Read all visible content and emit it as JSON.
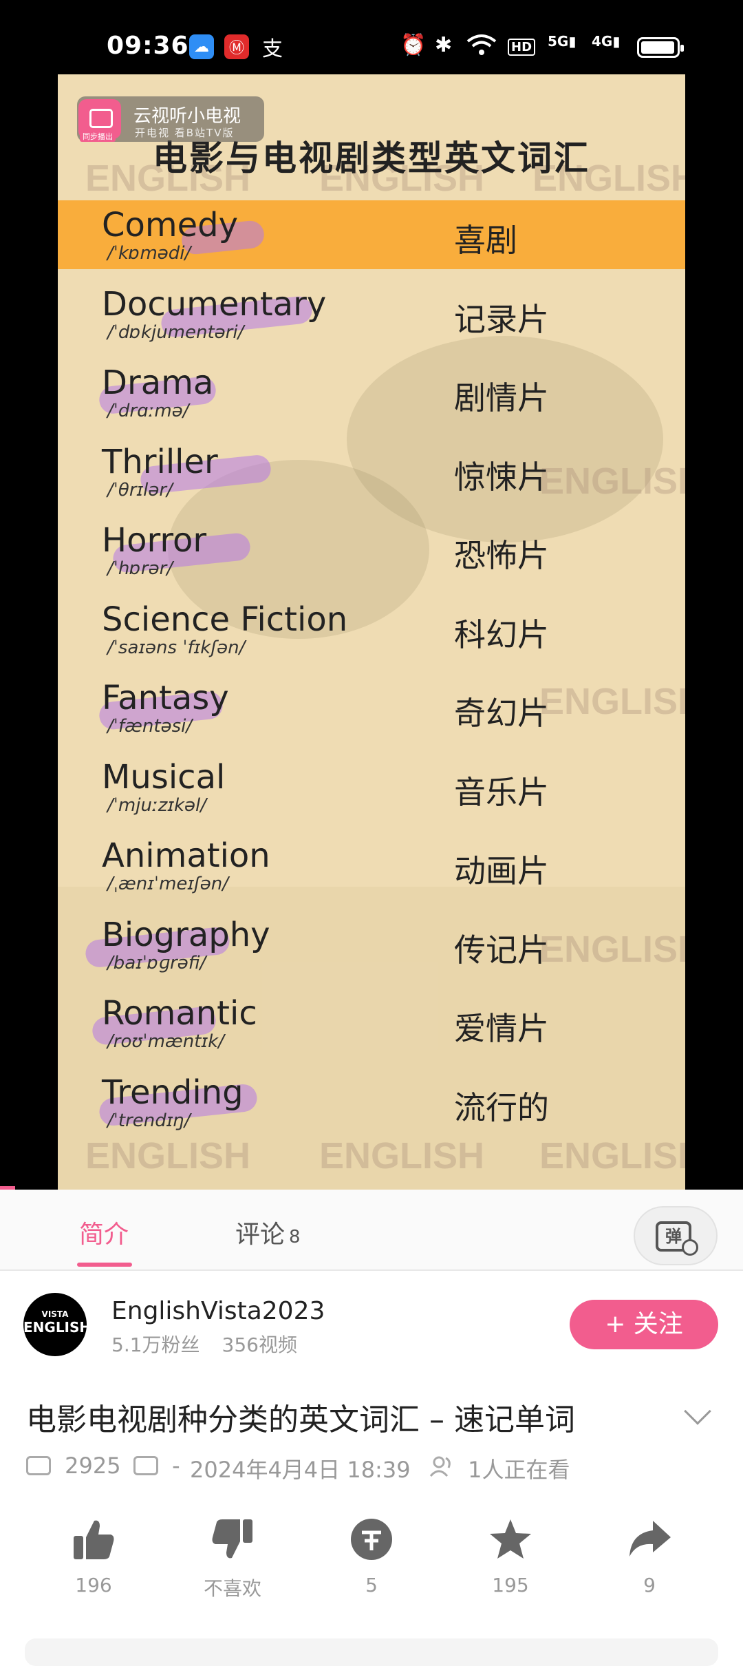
{
  "status_bar": {
    "time": "09:36",
    "network": "5G",
    "network2": "4G",
    "hd": "HD"
  },
  "video": {
    "tv_badge_title": "云视听小电视",
    "tv_badge_subtitle": "开电视 看B站TV版",
    "tv_badge_tag": "同步播出",
    "title": "电影与电视剧类型英文词汇",
    "watermark": "ENGLISH",
    "rows": [
      {
        "en": "Comedy",
        "ph": "/ˈkɒmədi/",
        "zh": "喜剧"
      },
      {
        "en": "Documentary",
        "ph": "/ˈdɒkjumentəri/",
        "zh": "记录片"
      },
      {
        "en": "Drama",
        "ph": "/ˈdrɑːmə/",
        "zh": "剧情片"
      },
      {
        "en": "Thriller",
        "ph": "/ˈθrɪlər/",
        "zh": "惊悚片"
      },
      {
        "en": "Horror",
        "ph": "/ˈhɒrər/",
        "zh": "恐怖片"
      },
      {
        "en": "Science Fiction",
        "ph": "/ˈsaɪəns ˈfɪkʃən/",
        "zh": "科幻片"
      },
      {
        "en": "Fantasy",
        "ph": "/ˈfæntəsi/",
        "zh": "奇幻片"
      },
      {
        "en": "Musical",
        "ph": "/ˈmjuːzɪkəl/",
        "zh": "音乐片"
      },
      {
        "en": "Animation",
        "ph": "/ˌænɪˈmeɪʃən/",
        "zh": "动画片"
      },
      {
        "en": "Biography",
        "ph": "/baɪˈɒɡrəfi/",
        "zh": "传记片"
      },
      {
        "en": "Romantic",
        "ph": "/roʊˈmæntɪk/",
        "zh": "爱情片"
      },
      {
        "en": "Trending",
        "ph": "/ˈtrendɪŋ/",
        "zh": "流行的"
      }
    ]
  },
  "tabs": {
    "intro": "简介",
    "comments": "评论",
    "comments_count": "8",
    "danmaku_glyph": "弹"
  },
  "uploader": {
    "avatar_top": "VISTA",
    "avatar_main": "ENGLISH",
    "name": "EnglishVista2023",
    "fans": "5.1万粉丝",
    "videos": "356视频",
    "follow": "+ 关注"
  },
  "info": {
    "title": "电影电视剧种分类的英文词汇 – 速记单词",
    "views": "2925",
    "danmaku": "-",
    "date": "2024年4月4日 18:39",
    "watching": "1人正在看"
  },
  "actions": {
    "like": "196",
    "dislike": "不喜欢",
    "coin": "5",
    "favorite": "195",
    "share": "9"
  },
  "colors": {
    "accent": "#f25d8e",
    "highlight": "#f9ad3c"
  }
}
